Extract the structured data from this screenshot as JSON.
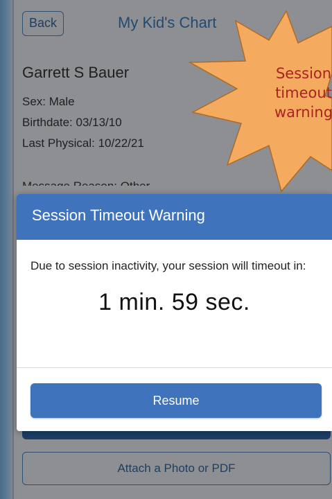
{
  "header": {
    "back_label": "Back",
    "title": "My Kid's Chart"
  },
  "patient": {
    "name": "Garrett S Bauer",
    "sex": "Sex: Male",
    "birthdate": "Birthdate: 03/13/10",
    "last_physical": "Last Physical: 10/22/21",
    "message_reason": "Message Reason: Other"
  },
  "annotation": {
    "text": "Session timeout warning",
    "fill_color": "#f4ab5f",
    "text_color": "#a6251d"
  },
  "dialog": {
    "title": "Session Timeout Warning",
    "message": "Due to session inactivity, your session will timeout in:",
    "countdown": "1 min. 59 sec.",
    "resume_label": "Resume",
    "accent_color": "#3f74bd"
  },
  "attach_label": "Attach a Photo or PDF"
}
